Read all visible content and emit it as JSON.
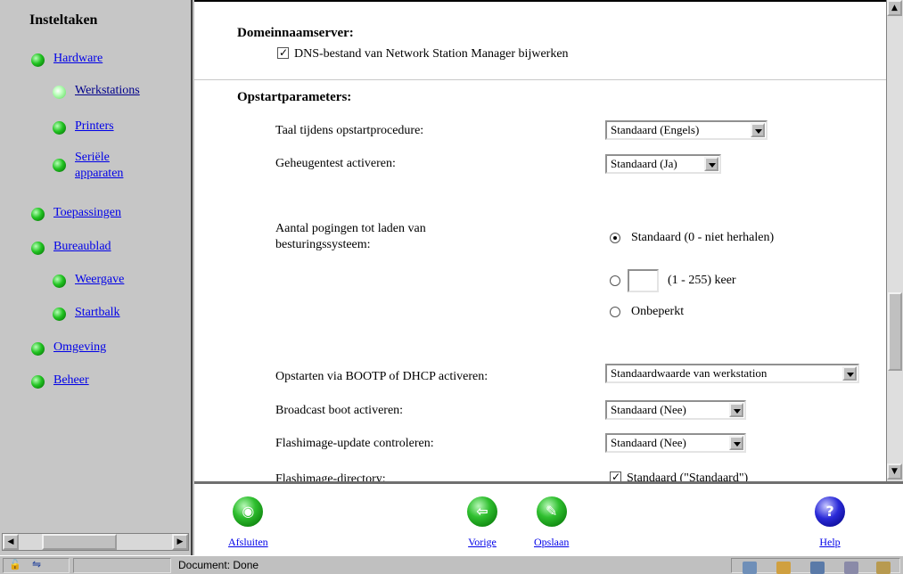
{
  "sidebar": {
    "title": "Insteltaken",
    "items": [
      {
        "label": "Hardware"
      },
      {
        "label": "Werkstations"
      },
      {
        "label": "Printers"
      },
      {
        "label_line1": "Seriële",
        "label_line2": "apparaten"
      },
      {
        "label": "Toepassingen"
      },
      {
        "label": "Bureaublad"
      },
      {
        "label": "Weergave"
      },
      {
        "label": "Startbalk"
      },
      {
        "label": "Omgeving"
      },
      {
        "label": "Beheer"
      }
    ]
  },
  "dns": {
    "heading": "Domeinnaamserver:",
    "checkbox_label": "DNS-bestand van Network Station Manager bijwerken",
    "checked": true
  },
  "boot": {
    "heading": "Opstartparameters:",
    "language_label": "Taal tijdens opstartprocedure:",
    "language_value": "Standaard (Engels)",
    "memtest_label": "Geheugentest activeren:",
    "memtest_value": "Standaard (Ja)",
    "retries_label_line1": "Aantal pogingen tot laden van",
    "retries_label_line2": "besturingssysteem:",
    "retries_opt_default": "Standaard (0 - niet herhalen)",
    "retries_opt_range": "(1 - 255) keer",
    "retries_opt_unlimited": "Onbeperkt",
    "retries_selected": "default",
    "bootp_label": "Opstarten via BOOTP of DHCP activeren:",
    "bootp_value": "Standaardwaarde van werkstation",
    "broadcast_label": "Broadcast boot activeren:",
    "broadcast_value": "Standaard (Nee)",
    "flash_label": "Flashimage-update controleren:",
    "flash_value": "Standaard (Nee)",
    "flashdir_label_partial": "Flashimage-directory:",
    "flashdir_value_partial": "Standaard (\"Standaard\")"
  },
  "actions": {
    "close": "Afsluiten",
    "previous": "Vorige",
    "save": "Opslaan",
    "help": "Help"
  },
  "status": {
    "text": "Document: Done"
  },
  "colors": {
    "link": "#0000e8",
    "sidebar_bg": "#c6c6c6",
    "bullet_green": "#22c322",
    "help_blue": "#2a2ad8"
  }
}
